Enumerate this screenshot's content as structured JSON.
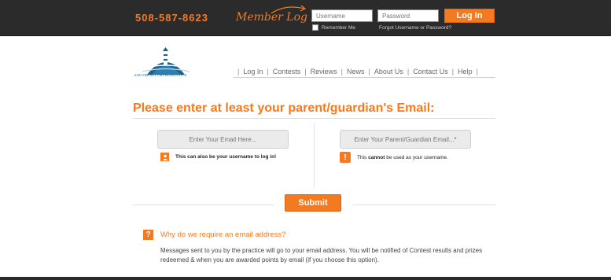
{
  "header": {
    "phone": "508-587-8623",
    "member_login": "Member Log In",
    "username_placeholder": "Username",
    "password_placeholder": "Password",
    "login_button": "Log In",
    "remember_me": "Remember Me",
    "forgot": "Forgot Username or Password?"
  },
  "logo": {
    "text": "SOUTHEAST ORTHODONTICS",
    "icon": "lighthouse-logo-icon"
  },
  "nav": {
    "items": [
      "Log In",
      "Contests",
      "Reviews",
      "News",
      "About Us",
      "Contact Us",
      "Help"
    ],
    "separator": "|"
  },
  "main": {
    "heading": "Please enter at least your parent/guardian's Email:",
    "email_placeholder": "Enter Your Email Here...",
    "parent_email_placeholder": "Enter Your Parent/Guardian Email...*",
    "left_note": "This can also be your username to log in!",
    "right_note_pre": "This ",
    "right_note_bold": "cannot",
    "right_note_post": " be used as your username.",
    "submit": "Submit"
  },
  "faq": {
    "question": "Why do we require an email address?",
    "answer": "Messages sent to you by the practice will go to your email address. You will be notified of Contest results and prizes redeemed & when you are awarded points by email (if you choose this option)."
  },
  "colors": {
    "accent": "#f47a20",
    "topbar": "#2b2b2b"
  }
}
